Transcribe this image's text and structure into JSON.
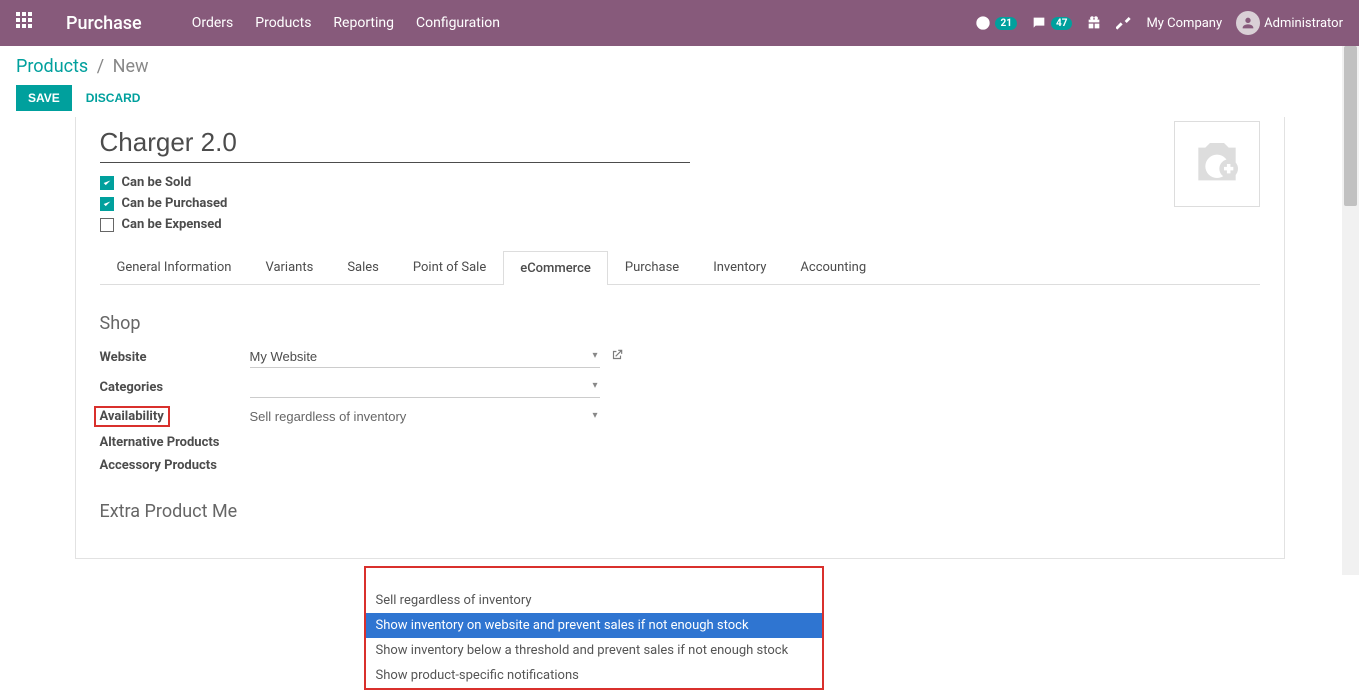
{
  "nav": {
    "brand": "Purchase",
    "menu": [
      "Orders",
      "Products",
      "Reporting",
      "Configuration"
    ],
    "clock_badge": "21",
    "chat_badge": "47",
    "company": "My Company",
    "user": "Administrator"
  },
  "breadcrumb": {
    "parent": "Products",
    "current": "New"
  },
  "buttons": {
    "save": "SAVE",
    "discard": "DISCARD"
  },
  "product": {
    "name": "Charger 2.0",
    "can_be_sold_label": "Can be Sold",
    "can_be_purchased_label": "Can be Purchased",
    "can_be_expensed_label": "Can be Expensed"
  },
  "tabs": [
    "General Information",
    "Variants",
    "Sales",
    "Point of Sale",
    "eCommerce",
    "Purchase",
    "Inventory",
    "Accounting"
  ],
  "active_tab": "eCommerce",
  "section_shop": "Shop",
  "fields": {
    "website_label": "Website",
    "website_value": "My Website",
    "categories_label": "Categories",
    "availability_label": "Availability",
    "availability_value": "Sell regardless of inventory",
    "alt_products_label": "Alternative Products",
    "acc_products_label": "Accessory Products"
  },
  "availability_options": [
    "Sell regardless of inventory",
    "Show inventory on website and prevent sales if not enough stock",
    "Show inventory below a threshold and prevent sales if not enough stock",
    "Show product-specific notifications"
  ],
  "availability_selected_index": 1,
  "section_extra": "Extra Product Me"
}
